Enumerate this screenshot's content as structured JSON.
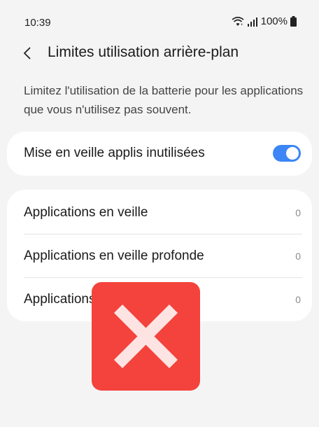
{
  "status": {
    "time": "10:39",
    "battery": "100%",
    "icons": [
      "wifi-icon",
      "signal-icon",
      "battery-icon"
    ]
  },
  "header": {
    "title": "Limites utilisation arrière-plan",
    "back_icon": "chevron-left-icon"
  },
  "description": "Limitez l'utilisation de la batterie pour les applications que vous n'utilisez pas souvent.",
  "toggle_card": {
    "label": "Mise en veille applis inutilisées",
    "enabled": true
  },
  "list": [
    {
      "label": "Applications en veille",
      "count": "0"
    },
    {
      "label": "Applications en veille profonde",
      "count": "0"
    },
    {
      "label": "Applications jamais en veille",
      "count": "0"
    }
  ],
  "overlay": {
    "icon": "close-icon",
    "color": "#f3433c"
  },
  "colors": {
    "accent": "#3c86f5",
    "background": "#f4f4f4",
    "card": "#ffffff"
  }
}
